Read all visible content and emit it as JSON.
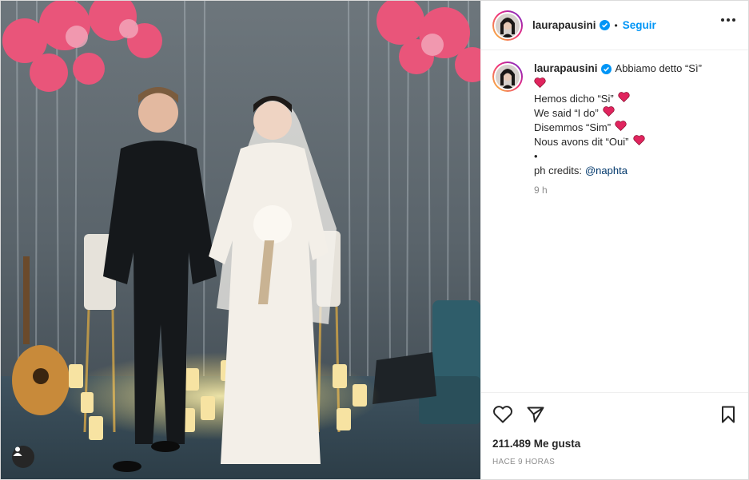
{
  "post": {
    "username": "laurapausini",
    "follow_label": "Seguir",
    "separator": "•",
    "caption": {
      "first_line": "Abbiamo detto “Sì”",
      "lines": [
        "Hemos dicho “Si”",
        "We said “I do”",
        "Disemmos “Sim”",
        "Nous avons dit “Oui”"
      ],
      "bullet": "•",
      "credits_prefix": "ph credits:",
      "credits_mention": "@naphta",
      "time": "9 h"
    },
    "likes": "211.489 Me gusta",
    "posted_ago": "HACE 9 HORAS"
  },
  "icons": {
    "verified": "verified-badge-icon",
    "more": "more-options-icon",
    "like": "heart-outline-icon",
    "share": "paper-plane-icon",
    "save": "bookmark-icon",
    "tag": "user-tag-icon",
    "emoji_heart": "red-heart-emoji"
  },
  "colors": {
    "accent": "#0095f6",
    "mention": "#00376b",
    "muted": "#8e8e8e",
    "heart": "#e0245e",
    "text": "#262626"
  }
}
